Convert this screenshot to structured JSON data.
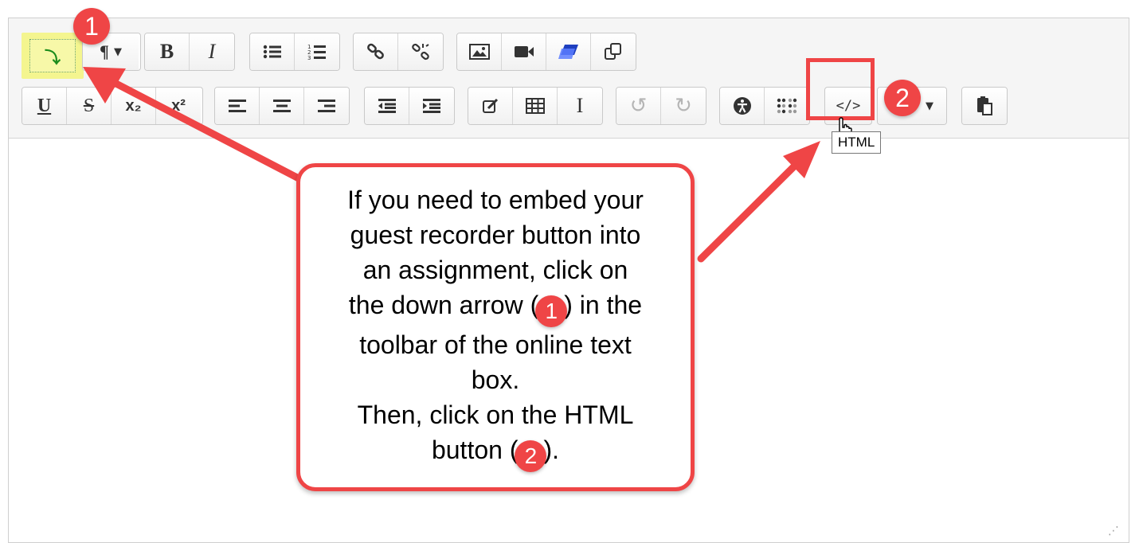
{
  "toolbar": {
    "row1": {
      "expand_icon": "⤵",
      "paragraph_label": "¶",
      "bold_label": "B",
      "italic_label": "I",
      "unordered_list_icon": "bulleted-list-icon",
      "ordered_list_icon": "numbered-list-icon",
      "link_icon": "link-icon",
      "unlink_icon": "unlink-icon",
      "image_icon": "image-icon",
      "video_icon": "video-camera-icon",
      "recorder_icon": "recorder-icon",
      "manage_files_icon": "manage-files-icon"
    },
    "row2": {
      "underline_label": "U",
      "strike_label": "S",
      "subscript_label": "x₂",
      "superscript_label": "x²",
      "align_left_icon": "align-left-icon",
      "align_center_icon": "align-center-icon",
      "align_right_icon": "align-right-icon",
      "outdent_icon": "outdent-icon",
      "indent_icon": "indent-icon",
      "equation_icon": "equation-icon",
      "table_icon": "table-icon",
      "clear_format_label": "I",
      "undo_icon": "undo-icon",
      "redo_icon": "redo-icon",
      "accessibility_icon": "accessibility-icon",
      "screenreader_icon": "screenreader-helper-icon",
      "html_label": "</>",
      "paste_icon": "paste-icon"
    },
    "html_tooltip": "HTML"
  },
  "annotations": {
    "badge_1": "1",
    "badge_2": "2",
    "callout": {
      "line_1": "If you need to embed your",
      "line_2": "guest recorder button into",
      "line_3": "an assignment, click on",
      "line_4a": "the down arrow (",
      "line_4b": ") in the",
      "line_5": "toolbar of the online text",
      "line_6": "box.",
      "line_7": "Then, click on the HTML",
      "line_8a": "button (",
      "line_8b": ")."
    }
  },
  "colors": {
    "accent_red": "#ef4546",
    "highlight_yellow": "#f4f58f",
    "toolbar_bg": "#f5f5f5"
  }
}
